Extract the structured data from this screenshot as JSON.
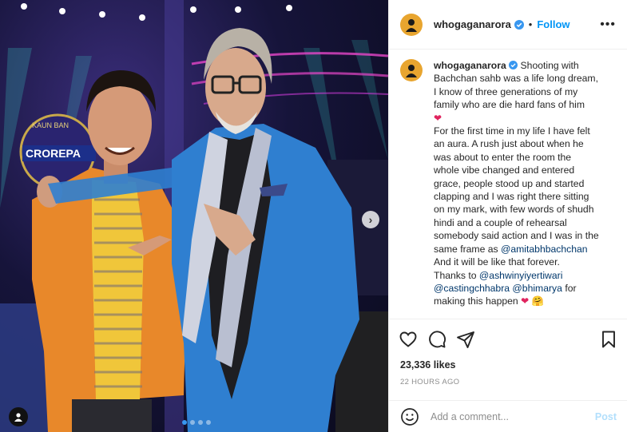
{
  "post": {
    "username": "whogaganarora",
    "follow_label": "Follow",
    "separator": "•",
    "more_icon": "more-horizontal-icon",
    "caption": {
      "username": "whogaganarora",
      "lines": [
        "Shooting with",
        "Bachchan sahb was a life long dream,",
        "I know of three generations of my",
        "family who are die hard fans of him",
        "For the first time in my life I have felt",
        "an aura. A rush just about when he",
        "was about to enter the room the",
        "whole vibe changed and entered",
        "grace, people stood up and started",
        "clapping and I was right there sitting",
        "on my mark, with few words of shudh",
        "hindi and a couple of rehearsal",
        "somebody said action and I was in the",
        "same frame as",
        "@amitabhbachchan",
        "And it will be like that forever.",
        "Thanks to",
        "@ashwinyiyertiwari",
        "@castingchhabra",
        "@bhimarya",
        "for",
        "making this happen"
      ],
      "heart_emoji": "❤",
      "hug_emoji": "🤗"
    },
    "likes": "23,336 likes",
    "timestamp": "22 HOURS AGO",
    "comment_placeholder": "Add a comment...",
    "post_label": "Post",
    "carousel_next": "›",
    "accent_color": "#0095f6",
    "verified_color": "#3897f0"
  }
}
